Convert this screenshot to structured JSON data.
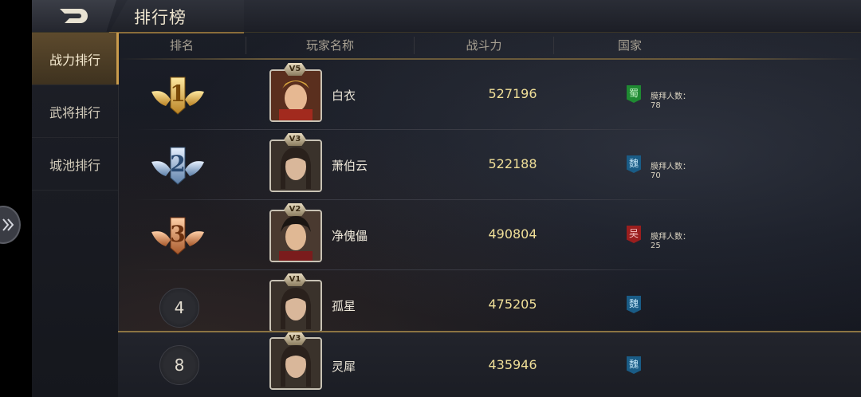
{
  "header": {
    "title": "排行榜"
  },
  "sidebar": {
    "items": [
      {
        "label": "战力排行",
        "active": true
      },
      {
        "label": "武将排行",
        "active": false
      },
      {
        "label": "城池排行",
        "active": false
      }
    ]
  },
  "table": {
    "columns": [
      "排名",
      "玩家名称",
      "战斗力",
      "国家"
    ],
    "rows": [
      {
        "rank": "1",
        "medal": "gold",
        "vip": "V5",
        "name": "白衣",
        "power": "527196",
        "country": "蜀",
        "country_color": "#1f8a32",
        "worship": "膜拜人数：78"
      },
      {
        "rank": "2",
        "medal": "silver",
        "vip": "V3",
        "name": "萧伯云",
        "power": "522188",
        "country": "魏",
        "country_color": "#1a5c86",
        "worship": "膜拜人数：70"
      },
      {
        "rank": "3",
        "medal": "bronze",
        "vip": "V2",
        "name": "净傀儡",
        "power": "490804",
        "country": "吴",
        "country_color": "#9a1e1e",
        "worship": "膜拜人数：25"
      },
      {
        "rank": "4",
        "medal": "none",
        "vip": "V1",
        "name": "孤星",
        "power": "475205",
        "country": "魏",
        "country_color": "#1a5c86",
        "worship": ""
      }
    ],
    "self_row": {
      "rank": "8",
      "vip": "V3",
      "name": "灵犀",
      "power": "435946",
      "country": "魏",
      "country_color": "#1a5c86"
    }
  }
}
